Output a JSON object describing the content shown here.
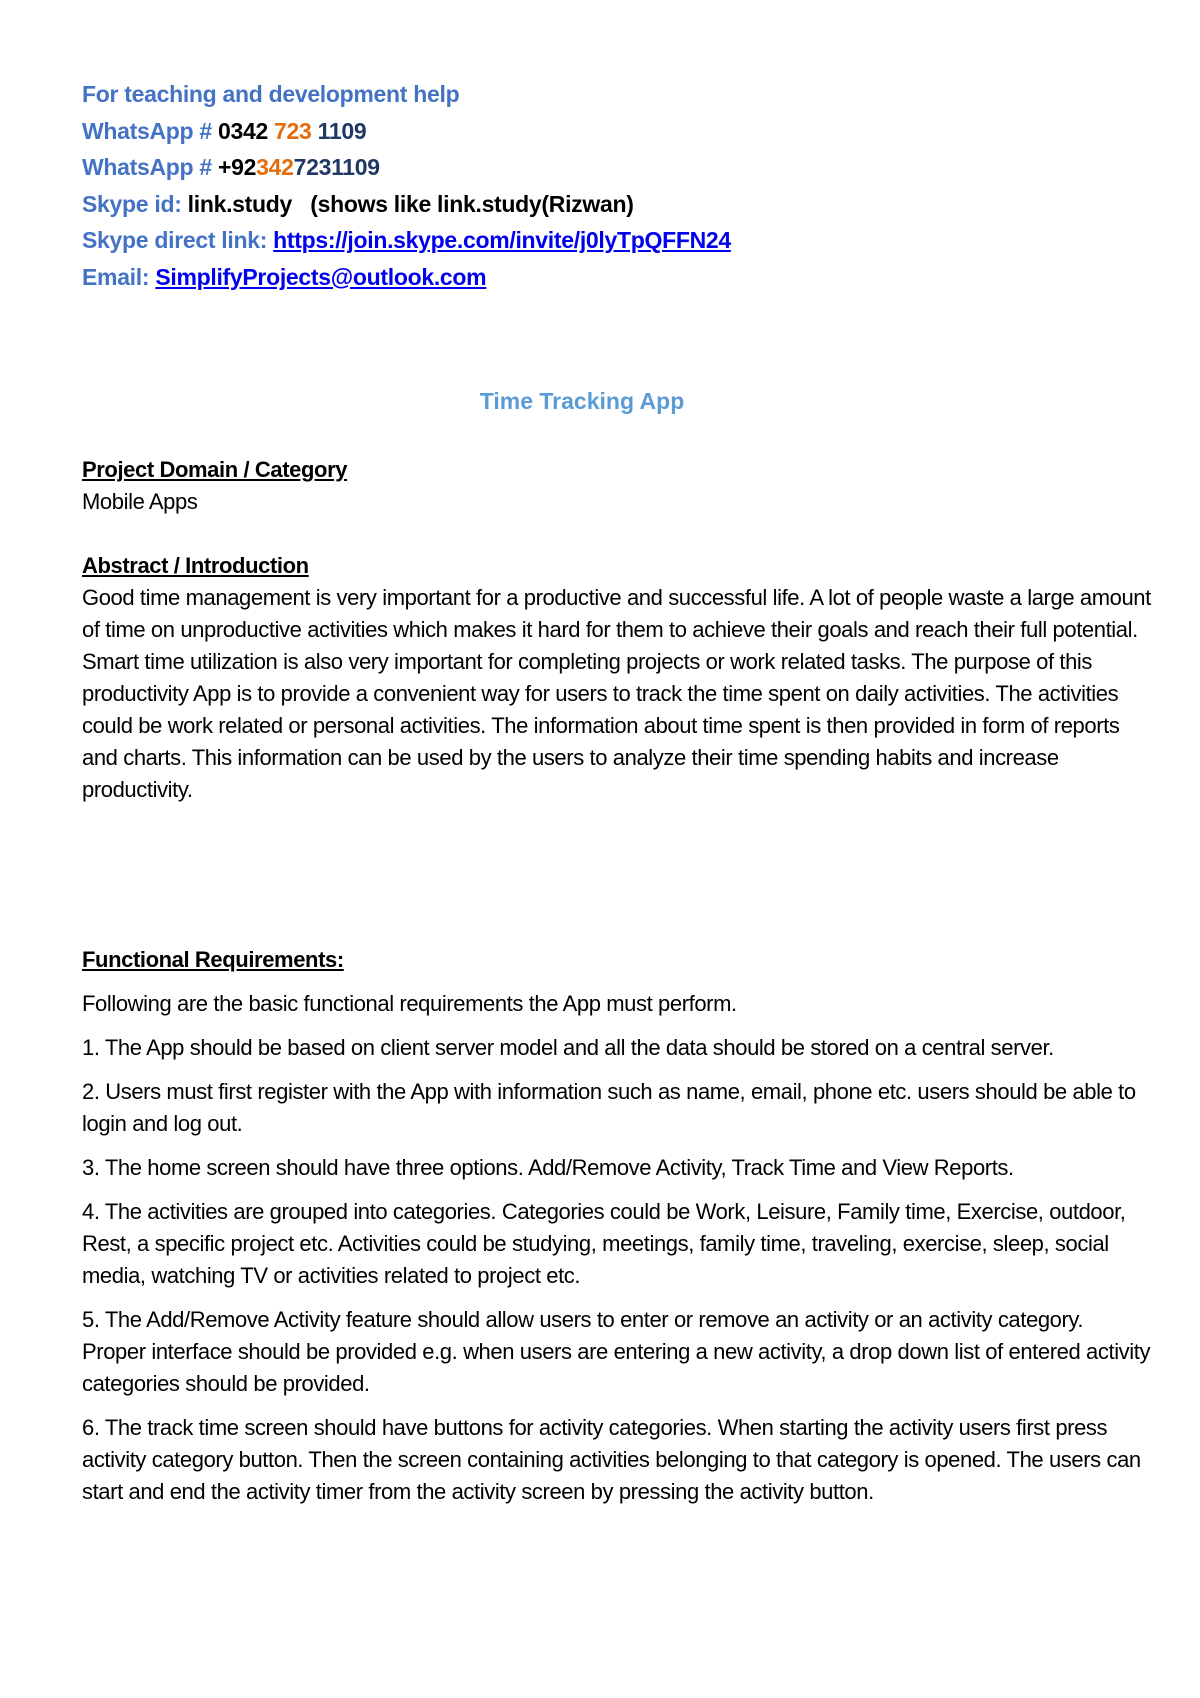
{
  "contact": {
    "line1": "For teaching and development help",
    "whatsapp1": {
      "label": "WhatsApp # ",
      "part1": "0342 ",
      "part2": "723",
      "part3": " 1109"
    },
    "whatsapp2": {
      "label": "WhatsApp # ",
      "part1": "+92",
      "part2": "342",
      "part3": "7231109"
    },
    "skype_id": {
      "label": "Skype id: ",
      "value": "link.study   (shows like link.study(Rizwan)"
    },
    "skype_link": {
      "label": "Skype direct link: ",
      "value": "https://join.skype.com/invite/j0lyTpQFFN24"
    },
    "email": {
      "label": "Email: ",
      "value": "SimplifyProjects@outlook.com"
    }
  },
  "document": {
    "title": "Time Tracking App",
    "domain_heading": "Project Domain / Category",
    "domain_value": "Mobile Apps",
    "abstract_heading": "Abstract / Introduction",
    "abstract_text": "Good time management is very important for a productive and successful life.  A lot of people waste a large amount of time on unproductive activities which makes it hard for them to achieve their goals and reach their full potential. Smart time utilization is also very important for completing projects or work related tasks. The purpose of this productivity App is to provide a convenient way for users to track the time spent on daily activities. The activities could be work related or personal activities. The information about time spent is then provided in form of  reports and charts. This information can be used by the users to analyze their time spending  habits and increase productivity.",
    "requirements_heading": "Functional Requirements:",
    "requirements_intro": "Following are the basic functional requirements the App must perform.",
    "requirements": [
      "1. The App should be based on client server model and all the data should be stored on a central server.",
      "2. Users must first register with the App with information such as name, email, phone etc.  users should be able to login and log out.",
      "3. The home screen should have three options. Add/Remove Activity, Track Time and View Reports.",
      "4. The activities are grouped into categories. Categories could be Work, Leisure, Family time, Exercise, outdoor, Rest, a specific project etc. Activities could be studying, meetings, family time, traveling, exercise, sleep, social media, watching TV or activities related to project etc.",
      "5. The Add/Remove Activity feature should allow users to enter or remove an activity or an  activity category.  Proper interface should be provided e.g. when users are entering a new activity, a drop down list of entered activity categories should be provided.",
      "6. The track time screen should have buttons for activity categories. When starting the activity users first press activity category button. Then the screen containing activities belonging to that category is opened. The users can start and end the activity timer from the activity screen by pressing the activity button."
    ]
  }
}
